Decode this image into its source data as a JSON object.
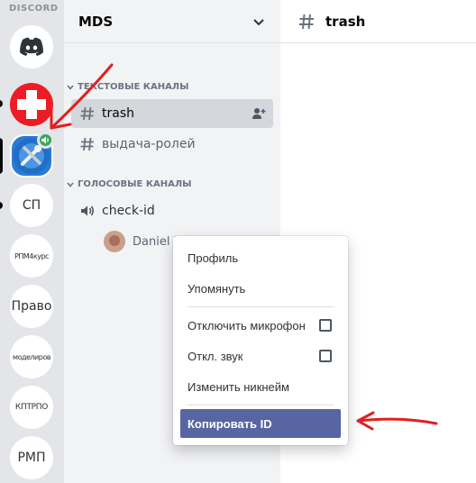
{
  "app": {
    "brand": "DISCORD"
  },
  "servers": [
    {
      "name": "Домой",
      "icon": "discord-logo-icon"
    },
    {
      "name": "Red cross",
      "icon": "red-cross-icon"
    },
    {
      "name": "MDS",
      "icon": "tools-icon",
      "badge": "voice-speaker-icon"
    },
    {
      "label": "СП"
    },
    {
      "label": "РПМ4курс"
    },
    {
      "label": "Право"
    },
    {
      "label": "моделиров"
    },
    {
      "label": "КПТРПО"
    },
    {
      "label": "РМП"
    }
  ],
  "guild": {
    "name": "MDS"
  },
  "categories": {
    "text": "ТЕКСТОВЫЕ КАНАЛЫ",
    "voice": "ГОЛОСОВЫЕ КАНАЛЫ"
  },
  "channels": {
    "text": [
      {
        "name": "trash",
        "active": true
      },
      {
        "name": "выдача-ролей"
      }
    ],
    "voice": [
      {
        "name": "check-id",
        "users": [
          {
            "name": "Daniel I"
          }
        ]
      }
    ]
  },
  "main": {
    "channel": "trash"
  },
  "context_menu": {
    "items": [
      {
        "label": "Профиль"
      },
      {
        "label": "Упомянуть"
      },
      {
        "label": "Отключить микрофон",
        "checkbox": false
      },
      {
        "label": "Откл. звук",
        "checkbox": false
      },
      {
        "label": "Изменить никнейм"
      },
      {
        "label": "Копировать ID",
        "highlighted": true
      }
    ]
  },
  "colors": {
    "accent": "#5865a3",
    "annotation": "#e02020",
    "rail": "#e3e5e8",
    "sidebar": "#f2f3f5"
  }
}
